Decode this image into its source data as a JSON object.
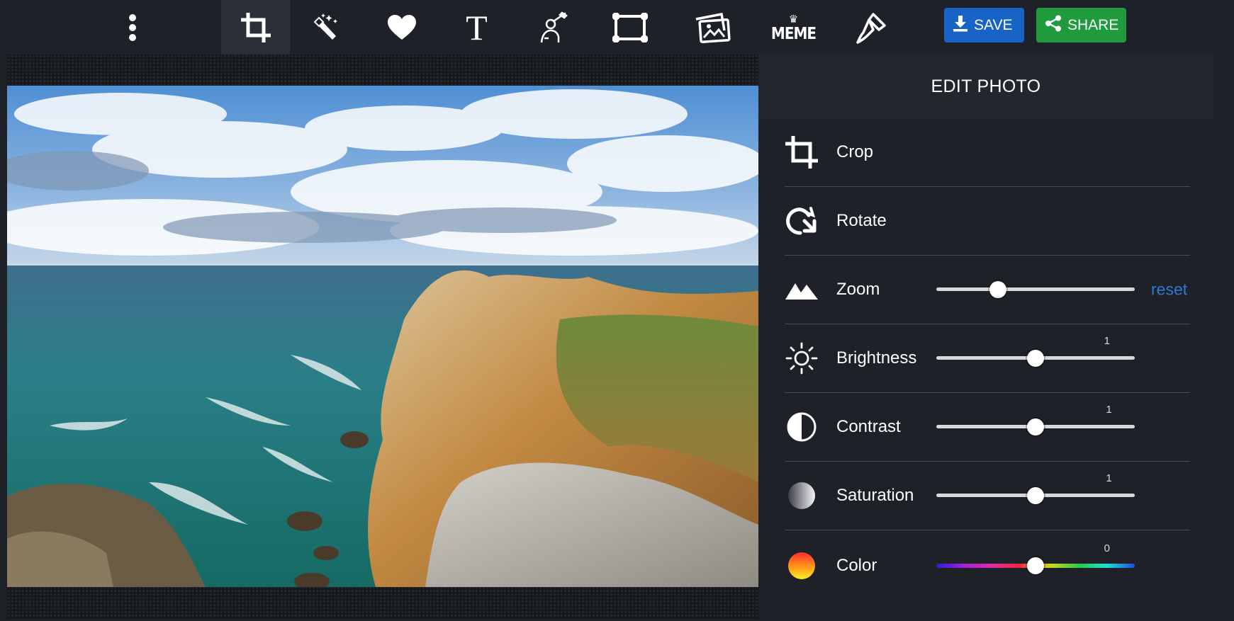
{
  "toolbar": {
    "more_icon": "more-vertical-icon",
    "tools": [
      {
        "name": "crop",
        "icon": "crop-icon",
        "active": true
      },
      {
        "name": "effects",
        "icon": "magic-wand-icon",
        "active": false
      },
      {
        "name": "stickers",
        "icon": "heart-icon",
        "active": false
      },
      {
        "name": "text",
        "icon": "text-icon",
        "active": false,
        "glyph": "T"
      },
      {
        "name": "paint",
        "icon": "paint-figure-icon",
        "active": false
      },
      {
        "name": "frames",
        "icon": "frame-icon",
        "active": false
      },
      {
        "name": "collage",
        "icon": "photo-icon",
        "active": false
      },
      {
        "name": "meme",
        "icon": "meme-icon",
        "active": false,
        "glyph": "MEME"
      },
      {
        "name": "retouch",
        "icon": "brush-icon",
        "active": false
      }
    ],
    "save_label": "SAVE",
    "share_label": "SHARE",
    "save_color": "#1763c6",
    "share_color": "#1f9a3d"
  },
  "panel": {
    "title": "EDIT PHOTO",
    "rows": [
      {
        "label": "Crop",
        "icon": "crop-icon"
      },
      {
        "label": "Rotate",
        "icon": "rotate-icon"
      },
      {
        "label": "Zoom",
        "icon": "mountains-icon",
        "slider": {
          "fraction": 0.31
        },
        "reset_label": "reset"
      },
      {
        "label": "Brightness",
        "icon": "sun-icon",
        "slider": {
          "fraction": 0.5,
          "value": "1"
        }
      },
      {
        "label": "Contrast",
        "icon": "contrast-icon",
        "slider": {
          "fraction": 0.5,
          "value": "1"
        }
      },
      {
        "label": "Saturation",
        "icon": "saturation-icon",
        "slider": {
          "fraction": 0.5,
          "value": "1"
        }
      },
      {
        "label": "Color",
        "icon": "color-icon",
        "slider": {
          "fraction": 0.5,
          "value": "0"
        }
      }
    ]
  }
}
